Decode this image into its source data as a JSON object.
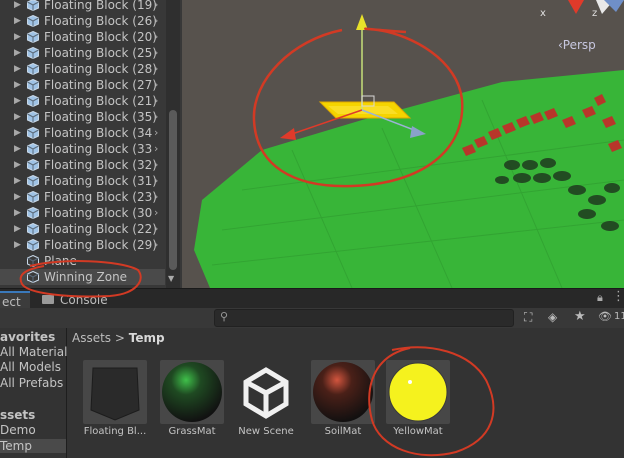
{
  "hierarchy": {
    "items": [
      {
        "label": "Floating Block (19)",
        "has_children": true
      },
      {
        "label": "Floating Block (26)",
        "has_children": true
      },
      {
        "label": "Floating Block (20)",
        "has_children": true
      },
      {
        "label": "Floating Block (25)",
        "has_children": true
      },
      {
        "label": "Floating Block (28)",
        "has_children": true
      },
      {
        "label": "Floating Block (27)",
        "has_children": true
      },
      {
        "label": "Floating Block (21)",
        "has_children": true
      },
      {
        "label": "Floating Block (35)",
        "has_children": true
      },
      {
        "label": "Floating Block (34",
        "has_children": true
      },
      {
        "label": "Floating Block (33",
        "has_children": true
      },
      {
        "label": "Floating Block (32)",
        "has_children": true
      },
      {
        "label": "Floating Block (31)",
        "has_children": true
      },
      {
        "label": "Floating Block (23)",
        "has_children": true
      },
      {
        "label": "Floating Block (30",
        "has_children": true
      },
      {
        "label": "Floating Block (22)",
        "has_children": true
      },
      {
        "label": "Floating Block (29)",
        "has_children": true
      },
      {
        "label": "Plane",
        "has_children": false
      },
      {
        "label": "Winning Zone",
        "has_children": false,
        "selected": true
      }
    ]
  },
  "scene": {
    "persp_label": "‹Persp",
    "axis_x": "x",
    "axis_z": "z",
    "ground_color": "#36b336",
    "selected_color": "#f5d400",
    "block_color": "#c0392b"
  },
  "panel": {
    "tab_project": "ect",
    "tab_console": "Console",
    "favorites_header": "avorites",
    "favorites": [
      "All Materials",
      "All Models",
      "All Prefabs"
    ],
    "assets_header": "ssets",
    "folders": [
      "Demo",
      "Temp"
    ],
    "breadcrumb_root": "Assets",
    "breadcrumb_sep": ">",
    "breadcrumb_current": "Temp",
    "visibility_count": "11",
    "assets": [
      {
        "name": "Floating Bl...",
        "icon": "floating-block-prefab-icon"
      },
      {
        "name": "GrassMat",
        "icon": "grass-material-icon"
      },
      {
        "name": "New Scene",
        "icon": "unity-scene-icon"
      },
      {
        "name": "SoilMat",
        "icon": "soil-material-icon"
      },
      {
        "name": "YellowMat",
        "icon": "yellow-material-icon"
      }
    ]
  },
  "annotation_color": "#d23a24"
}
